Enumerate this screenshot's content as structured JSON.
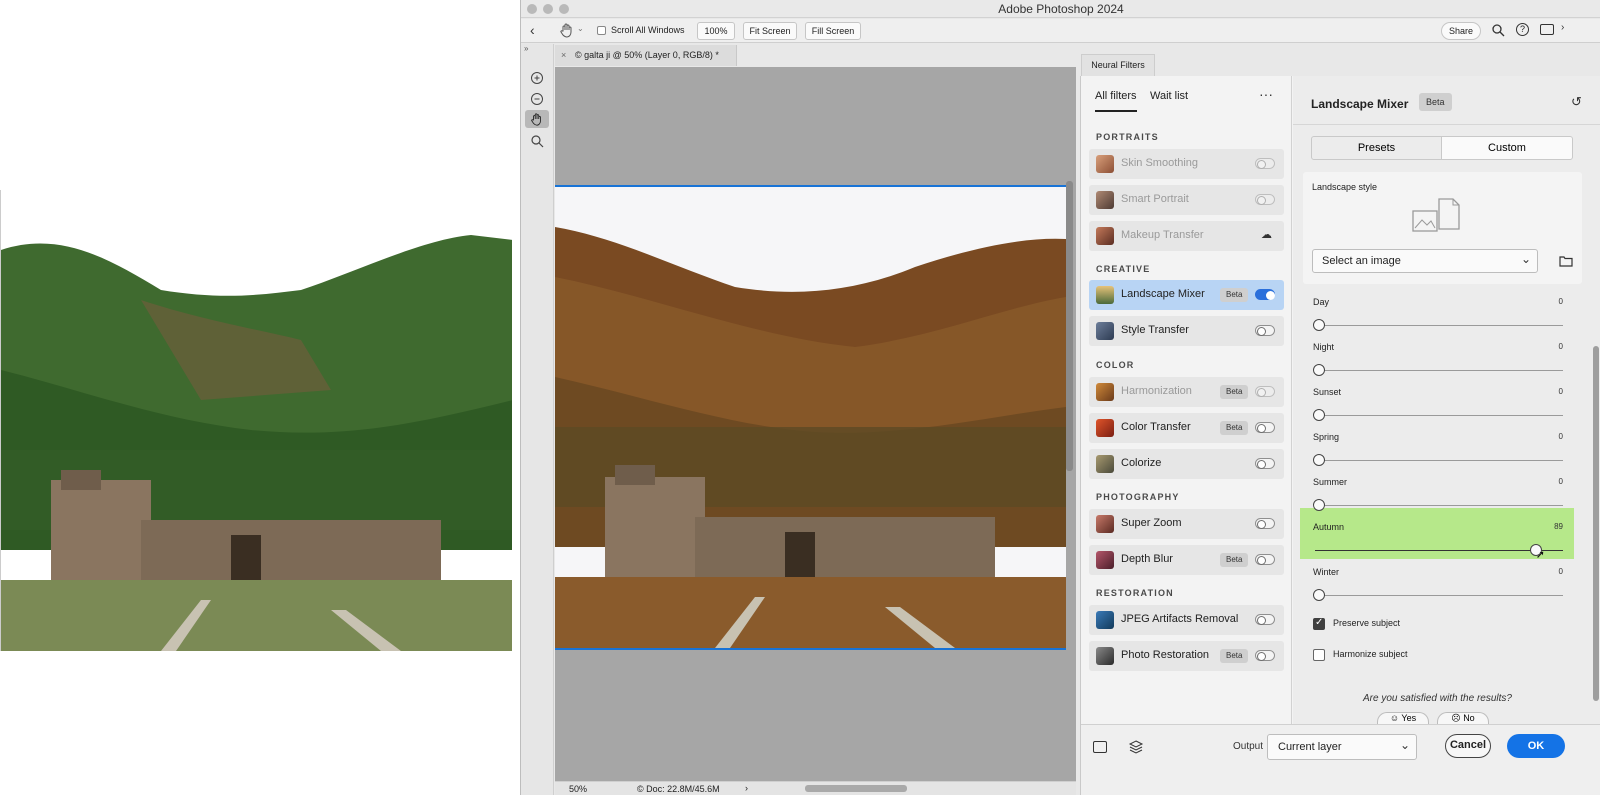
{
  "app": {
    "title": "Adobe Photoshop 2024"
  },
  "options_bar": {
    "scroll_all_windows": "Scroll All Windows",
    "zoom_100": "100%",
    "fit_screen": "Fit Screen",
    "fill_screen": "Fill Screen",
    "share": "Share"
  },
  "document": {
    "tab_title": "© galta ji @ 50% (Layer 0, RGB/8) *",
    "zoom": "50%",
    "doc_info": "© Doc: 22.8M/45.6M"
  },
  "neural_filters": {
    "panel_title": "Neural Filters",
    "tabs": {
      "all": "All filters",
      "wait": "Wait list"
    },
    "sections": [
      {
        "name": "PORTRAITS",
        "items": [
          {
            "label": "Skin Smoothing",
            "beta": "",
            "state": "off",
            "dim": true
          },
          {
            "label": "Smart Portrait",
            "beta": "",
            "state": "off",
            "dim": true
          },
          {
            "label": "Makeup Transfer",
            "beta": "",
            "state": "download",
            "dim": true
          }
        ]
      },
      {
        "name": "CREATIVE",
        "items": [
          {
            "label": "Landscape Mixer",
            "beta": "Beta",
            "state": "on",
            "dim": false
          },
          {
            "label": "Style Transfer",
            "beta": "",
            "state": "off",
            "dim": false
          }
        ]
      },
      {
        "name": "COLOR",
        "items": [
          {
            "label": "Harmonization",
            "beta": "Beta",
            "state": "off",
            "dim": true
          },
          {
            "label": "Color Transfer",
            "beta": "Beta",
            "state": "off",
            "dim": false
          },
          {
            "label": "Colorize",
            "beta": "",
            "state": "off",
            "dim": false
          }
        ]
      },
      {
        "name": "PHOTOGRAPHY",
        "items": [
          {
            "label": "Super Zoom",
            "beta": "",
            "state": "off",
            "dim": false
          },
          {
            "label": "Depth Blur",
            "beta": "Beta",
            "state": "off",
            "dim": false
          }
        ]
      },
      {
        "name": "RESTORATION",
        "items": [
          {
            "label": "JPEG Artifacts Removal",
            "beta": "",
            "state": "off",
            "dim": false
          },
          {
            "label": "Photo Restoration",
            "beta": "Beta",
            "state": "off",
            "dim": false
          }
        ]
      }
    ],
    "settings": {
      "title": "Landscape Mixer",
      "beta": "Beta",
      "tab_presets": "Presets",
      "tab_custom": "Custom",
      "style_label": "Landscape style",
      "select_image": "Select an image",
      "sliders": [
        {
          "label": "Day",
          "value": "0",
          "pct": 0,
          "highlight": false
        },
        {
          "label": "Night",
          "value": "0",
          "pct": 0,
          "highlight": false
        },
        {
          "label": "Sunset",
          "value": "0",
          "pct": 0,
          "highlight": false
        },
        {
          "label": "Spring",
          "value": "0",
          "pct": 0,
          "highlight": false
        },
        {
          "label": "Summer",
          "value": "0",
          "pct": 0,
          "highlight": false
        },
        {
          "label": "Autumn",
          "value": "89",
          "pct": 0.89,
          "highlight": true
        },
        {
          "label": "Winter",
          "value": "0",
          "pct": 0,
          "highlight": false
        }
      ],
      "preserve_subject": "Preserve subject",
      "harmonize_subject": "Harmonize subject",
      "satisfied_question": "Are you satisfied with the results?",
      "yes": "Yes",
      "no": "No"
    },
    "footer": {
      "output_label": "Output",
      "output_value": "Current layer",
      "cancel": "Cancel",
      "ok": "OK"
    }
  },
  "colors": {
    "accent": "#1473e6",
    "highlight": "#b6e88a",
    "selected_row": "#b8d4f4"
  }
}
